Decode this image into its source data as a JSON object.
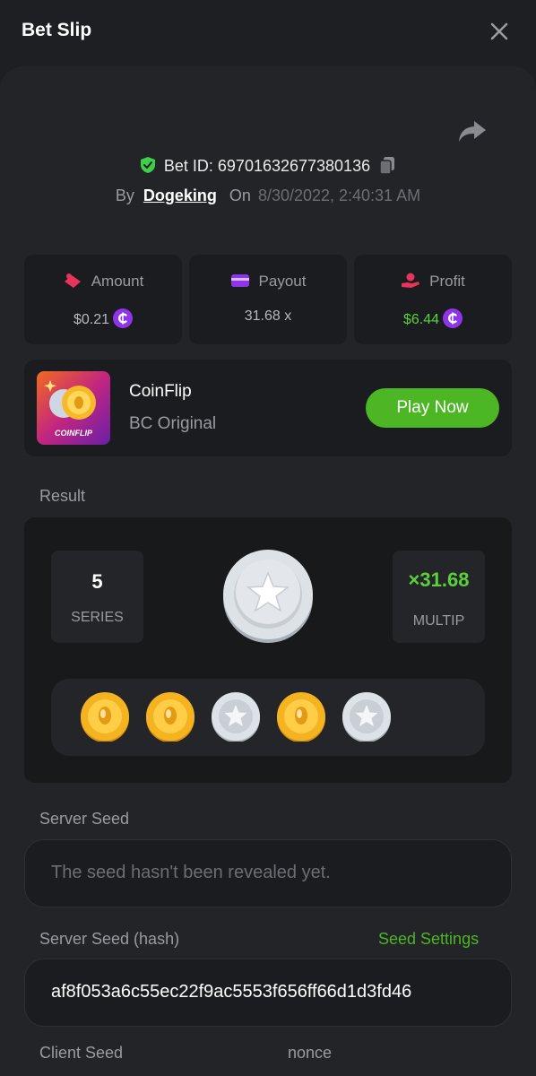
{
  "header": {
    "title": "Bet Slip",
    "close_icon": "close-icon"
  },
  "bet": {
    "id_label": "Bet ID: 69701632677380136",
    "by_label": "By",
    "user": "Dogeking",
    "on_label": "On",
    "date": "8/30/2022, 2:40:31 AM"
  },
  "stats": {
    "amount": {
      "label": "Amount",
      "value": "$0.21"
    },
    "payout": {
      "label": "Payout",
      "value": "31.68 x"
    },
    "profit": {
      "label": "Profit",
      "value": "$6.44"
    }
  },
  "game": {
    "name": "CoinFlip",
    "subtitle": "BC Original",
    "thumb_text": "COINFLIP",
    "play_label": "Play Now"
  },
  "result": {
    "section_label": "Result",
    "series_value": "5",
    "series_label": "SERIES",
    "multiplier_value": "×31.68",
    "multiplier_label": "MULTIP",
    "flips": [
      "gold",
      "gold",
      "silver",
      "gold",
      "silver"
    ]
  },
  "server_seed": {
    "label": "Server Seed",
    "placeholder": "The seed hasn't been revealed yet."
  },
  "server_seed_hash": {
    "label": "Server Seed (hash)",
    "settings_link": "Seed Settings",
    "value": "af8f053a6c55ec22f9ac5553f656ff66d1d3fd46"
  },
  "client_seed": {
    "label": "Client Seed"
  },
  "nonce": {
    "label": "nonce"
  },
  "colors": {
    "accent_green": "#4cb624",
    "profit_green": "#5bd03b",
    "background": "#1e1f23",
    "card": "#1b1c1f"
  }
}
